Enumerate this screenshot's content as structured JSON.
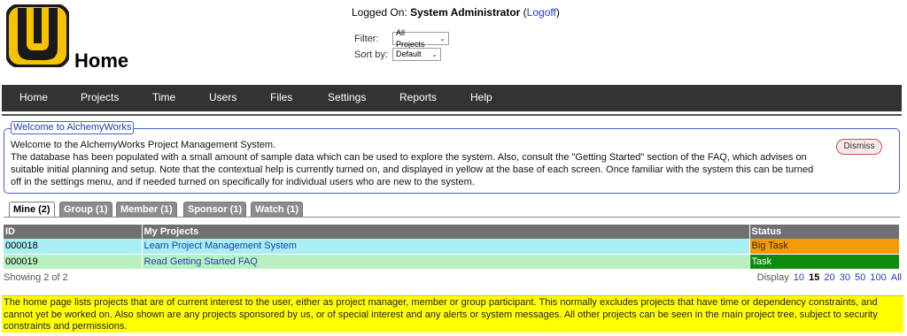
{
  "header": {
    "title": "Home",
    "logged_on_label": "Logged On:",
    "user": "System Administrator",
    "logoff_open": "(",
    "logoff": "Logoff",
    "logoff_close": ")",
    "filter_label": "Filter:",
    "filter_value": "All Projects",
    "sort_label": "Sort by:",
    "sort_value": "Default",
    "logo_colors": {
      "primary": "#f5c400",
      "outline": "#1a1a1a"
    }
  },
  "nav": {
    "items": [
      "Home",
      "Projects",
      "Time",
      "Users",
      "Files",
      "Settings",
      "Reports",
      "Help"
    ]
  },
  "welcome": {
    "legend": "Welcome to AlchemyWorks",
    "line1": "Welcome to the AlchemyWorks Project Management System.",
    "body": "The database has been populated with a small amount of sample data which can be used to explore the system. Also, consult the \"Getting Started\" section of the FAQ, which advises on suitable initial planning and setup. Note that the contextual help is currently turned on, and displayed in yellow at the base of each screen. Once familiar with the system this can be turned off in the settings menu, and if needed turned on specifically for individual users who are new to the system.",
    "dismiss": "Dismiss"
  },
  "tabs": [
    "Mine (2)",
    "Group (1)",
    "Member (1)",
    "Sponsor (1)",
    "Watch (1)"
  ],
  "table": {
    "headers": [
      "ID",
      "My Projects",
      "Status"
    ],
    "rows": [
      {
        "id": "000018",
        "project": "Learn Project Management System",
        "status": "Big Task"
      },
      {
        "id": "000019",
        "project": "Read Getting Started FAQ",
        "status": "Task"
      }
    ]
  },
  "footer": {
    "showing": "Showing 2 of 2",
    "display_label": "Display",
    "page_sizes": [
      "10",
      "15",
      "20",
      "30",
      "50",
      "100",
      "All"
    ],
    "current_page_size": "15"
  },
  "help": {
    "text": "The home page lists projects that are of current interest to the user, either as project manager, member or group participant. This normally excludes projects that have time or dependency constraints, and cannot yet be worked on. Also shown are any projects sponsored by us, or of special interest and any alerts or system messages. All other projects can be seen in the main project tree, subject to security constraints and permissions."
  },
  "colors": {
    "nav_bg": "#333333",
    "accent_link": "#1a3fb8",
    "big_task": "#f59a0a",
    "task": "#0e8a0e",
    "help_bg": "#ffff00"
  }
}
